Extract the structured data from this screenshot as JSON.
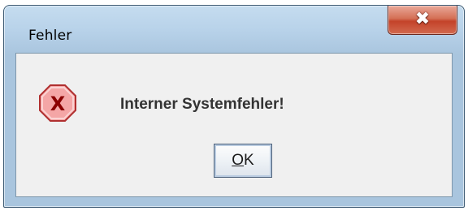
{
  "window": {
    "title": "Fehler",
    "close_glyph": "✖",
    "close_icon": "close-icon"
  },
  "dialog": {
    "icon": "error-icon",
    "icon_symbol": "X",
    "message": "Interner Systemfehler!",
    "ok_button": {
      "mnemonic": "O",
      "rest": "K"
    }
  },
  "colors": {
    "error_icon_fill": "#f4a6a6",
    "error_icon_border": "#b03030",
    "error_icon_symbol": "#8b0000",
    "close_button": "#c4432a"
  }
}
